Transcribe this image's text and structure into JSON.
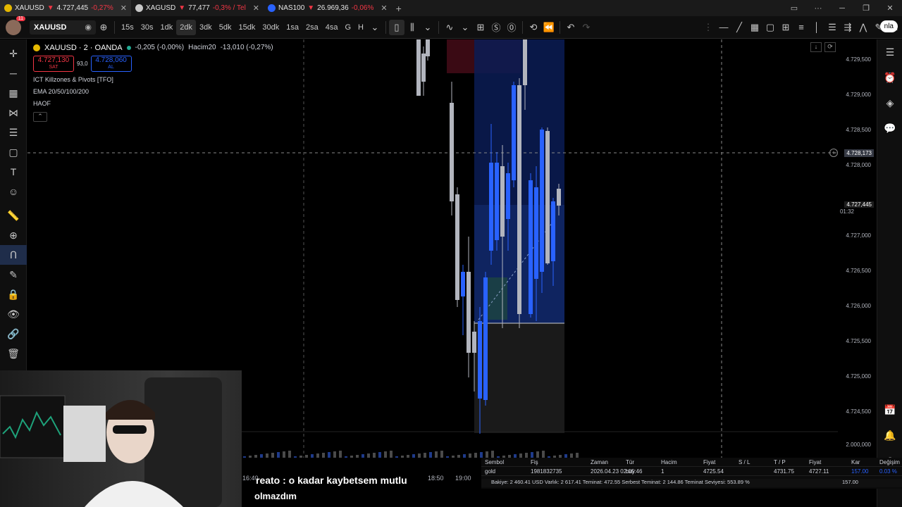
{
  "tabs": [
    {
      "name": "XAUUSD",
      "change_arrow": "▼",
      "price": "4.727,445",
      "change": "-0,27%",
      "icon_color": "#e5b800"
    },
    {
      "name": "XAGUSD",
      "change_arrow": "▼",
      "price": "77,477",
      "change": "-0,3% / Tel",
      "icon_color": "#c8c8c8"
    },
    {
      "name": "NAS100",
      "change_arrow": "▼",
      "price": "26.969,36",
      "change": "-0,06%",
      "icon_color": "#2962ff",
      "icon_text": "100"
    }
  ],
  "toolbar": {
    "notification_count": "11",
    "symbol": "XAUUSD",
    "intervals": [
      "15s",
      "30s",
      "1dk",
      "2dk",
      "3dk",
      "5dk",
      "15dk",
      "30dk",
      "1sa",
      "2sa",
      "4sa",
      "G",
      "H"
    ],
    "selected_interval": "2dk",
    "publish_label": "nla"
  },
  "legend": {
    "title": "XAUUSD · 2 · OANDA",
    "change": "-0,205 (-0,00%)",
    "volume_label": "Hacim",
    "volume_period": "20",
    "volume_value": "-13,010 (-0,27%)",
    "sell_price": "4.727,130",
    "sell_label": "SAT",
    "spread": "93,0",
    "buy_price": "4.728,060",
    "buy_label": "AL",
    "indicators": [
      "ICT Killzones & Pivots [TFO]",
      "EMA 20/50/100/200",
      "HAOF"
    ]
  },
  "price_axis": {
    "labels": [
      "4.729,500",
      "4.729,000",
      "4.728,500",
      "4.728,000",
      "4.727,000",
      "4.726,500",
      "4.726,000",
      "4.725,500",
      "4.725,000",
      "4.724,500",
      "2.000,000"
    ],
    "crosshair_price": "4.728,173",
    "last_price": "4.727,445",
    "countdown": "01:32"
  },
  "time_axis": {
    "labels": [
      "16:40",
      "18:50",
      "19:00"
    ]
  },
  "positions": {
    "headers": [
      "Sembol",
      "Fiş",
      "Zaman",
      "Tür",
      "Hacim",
      "Fiyat",
      "S / L",
      "T / P",
      "Fiyat",
      "Kar",
      "Değişim"
    ],
    "row": [
      "gold",
      "1981832735",
      "2026.04.23 02:05:46",
      "buy",
      "1",
      "4725.54",
      "",
      "4731.75",
      "4727.11",
      "157.00",
      "0.03 %"
    ],
    "balance_line": "Bakiye: 2 460.41 USD  Varlık: 2 617.41  Teminat: 472.55  Serbest Teminat: 2 144.86  Teminat Seviyesi: 553.89 %",
    "balance_profit": "157.00"
  },
  "caption": {
    "line1": "reato : o kadar kaybetsem mutlu",
    "line2": "olmazdım"
  },
  "colors": {
    "bull": "#2962ff",
    "bear": "#b2b5be",
    "sell": "#f23645",
    "buy": "#2962ff"
  }
}
